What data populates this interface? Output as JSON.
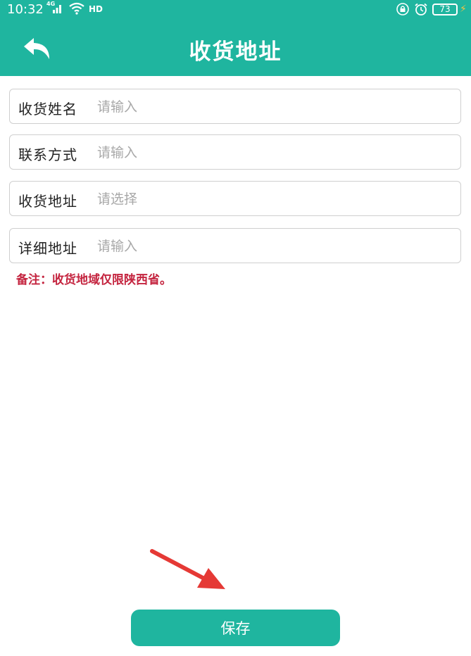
{
  "status_bar": {
    "time": "10:32",
    "network": "4G",
    "hd": "HD",
    "battery": "73"
  },
  "header": {
    "title": "收货地址"
  },
  "form": {
    "fields": [
      {
        "label": "收货姓名",
        "placeholder": "请输入",
        "value": ""
      },
      {
        "label": "联系方式",
        "placeholder": "请输入",
        "value": ""
      },
      {
        "label": "收货地址",
        "placeholder": "请选择",
        "value": ""
      },
      {
        "label": "详细地址",
        "placeholder": "请输入",
        "value": ""
      }
    ],
    "note": "备注：收货地域仅限陕西省。"
  },
  "save_button": {
    "label": "保存"
  },
  "colors": {
    "accent": "#1fb59f",
    "note_text": "#c4243f",
    "annotation_arrow": "#e53935"
  }
}
